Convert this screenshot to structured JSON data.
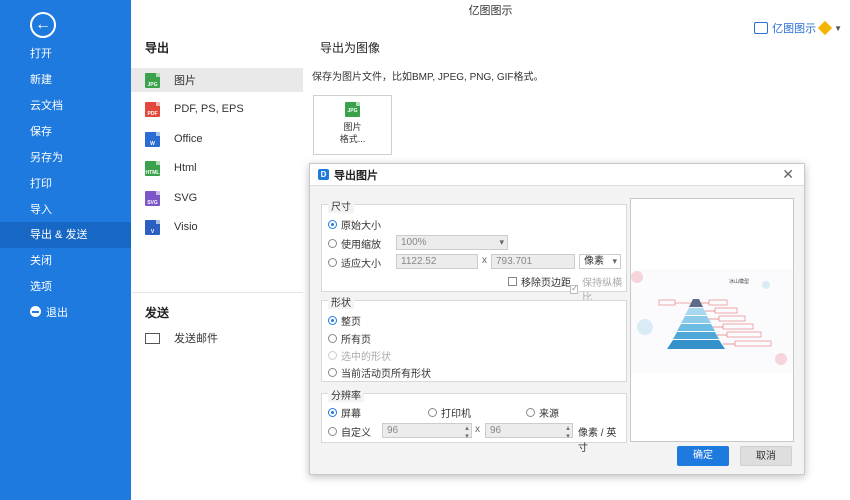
{
  "window": {
    "title": "亿图图示",
    "account_label": "亿图图示"
  },
  "sidebar": {
    "items": [
      {
        "label": "打开"
      },
      {
        "label": "新建"
      },
      {
        "label": "云文档"
      },
      {
        "label": "保存"
      },
      {
        "label": "另存为"
      },
      {
        "label": "打印"
      },
      {
        "label": "导入"
      },
      {
        "label": "导出 & 发送"
      },
      {
        "label": "关闭"
      },
      {
        "label": "选项"
      },
      {
        "label": "退出"
      }
    ],
    "active_index": 7
  },
  "export_panel": {
    "heading": "导出",
    "categories": [
      {
        "label": "图片",
        "icon": "jpg-file-icon",
        "badge": "JPG",
        "color": "#3aa24a"
      },
      {
        "label": "PDF, PS, EPS",
        "icon": "pdf-file-icon",
        "badge": "PDF",
        "color": "#e2493b"
      },
      {
        "label": "Office",
        "icon": "word-file-icon",
        "badge": "W",
        "color": "#2b6cd4"
      },
      {
        "label": "Html",
        "icon": "html-file-icon",
        "badge": "HTML",
        "color": "#3aa24a"
      },
      {
        "label": "SVG",
        "icon": "svg-file-icon",
        "badge": "SVG",
        "color": "#7b57c8"
      },
      {
        "label": "Visio",
        "icon": "visio-file-icon",
        "badge": "V",
        "color": "#2b5fc1"
      }
    ],
    "send_heading": "发送",
    "send_items": [
      {
        "label": "发送邮件",
        "icon": "mail-icon"
      }
    ]
  },
  "main": {
    "title": "导出为图像",
    "description": "保存为图片文件，比如BMP, JPEG, PNG, GIF格式。",
    "tile_line1": "图片",
    "tile_line2": "格式..."
  },
  "dialog": {
    "title": "导出图片",
    "size_group": {
      "label": "尺寸",
      "original": "原始大小",
      "use_zoom": "使用缩放",
      "zoom_value": "100%",
      "fit_size": "适应大小",
      "width_value": "1122.52",
      "height_value": "793.701",
      "times_sign": "x",
      "unit_value": "像素",
      "remove_margin": "移除页边距",
      "keep_ratio": "保持纵横比"
    },
    "shape_group": {
      "label": "形状",
      "whole_page": "整页",
      "all_pages": "所有页",
      "selected_shapes": "选中的形状",
      "current_page_shapes": "当前活动页所有形状"
    },
    "resolution_group": {
      "label": "分辨率",
      "screen": "屏幕",
      "printer": "打印机",
      "source": "来源",
      "custom": "自定义",
      "dpi_x": "96",
      "dpi_y": "96",
      "times_sign": "x",
      "unit": "像素 / 英寸"
    },
    "preview_title": "冰山模型",
    "ok_label": "确定",
    "cancel_label": "取消"
  },
  "colors": {
    "accent": "#1f7ae0",
    "accent_dark": "#1767c4"
  }
}
